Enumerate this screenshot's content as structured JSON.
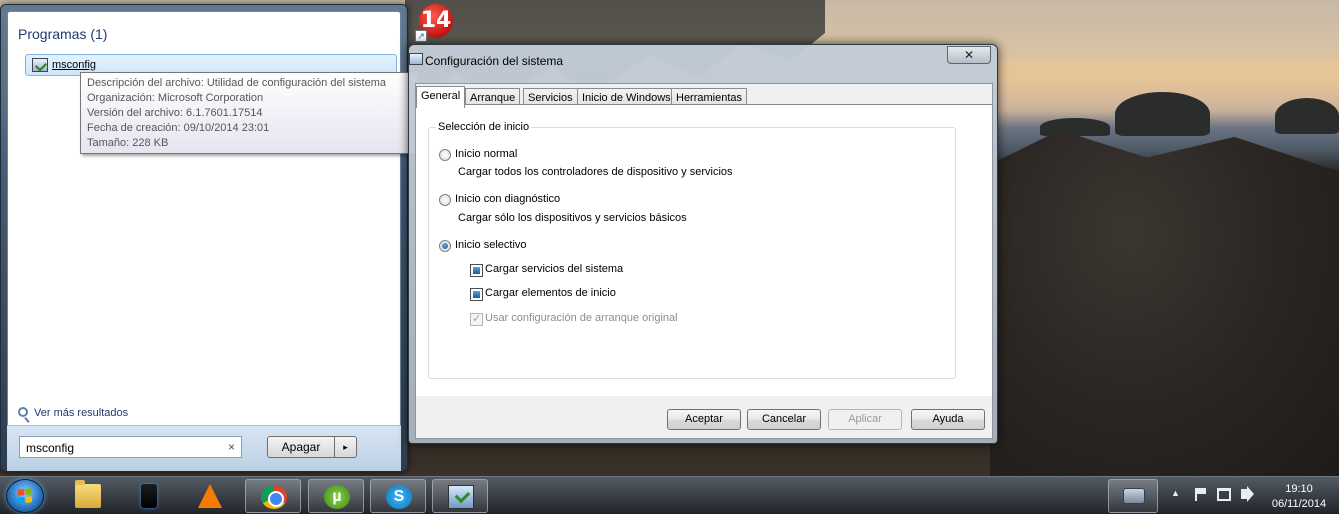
{
  "start_menu": {
    "programs_header": "Programas (1)",
    "program_result": "msconfig",
    "tooltip_lines": [
      "Descripción del archivo: Utilidad de configuración del sistema",
      "Organización: Microsoft Corporation",
      "Versión del archivo: 6.1.7601.17514",
      "Fecha de creación: 09/10/2014 23:01",
      "Tamaño: 228 KB"
    ],
    "more_results": "Ver más resultados",
    "search_value": "msconfig",
    "clear_glyph": "×",
    "shutdown_label": "Apagar",
    "shutdown_arrow": "▸"
  },
  "desktop": {
    "shortcut_badge": "14"
  },
  "window": {
    "title": "Configuración del sistema",
    "close_glyph": "✕",
    "tabs": [
      "General",
      "Arranque",
      "Servicios",
      "Inicio de Windows",
      "Herramientas"
    ],
    "active_tab": "General",
    "group_title": "Selección de inicio",
    "options": [
      {
        "label": "Inicio normal",
        "desc": "Cargar todos los controladores de dispositivo y servicios",
        "checked": false
      },
      {
        "label": "Inicio con diagnóstico",
        "desc": "Cargar sólo los dispositivos y servicios básicos",
        "checked": false
      },
      {
        "label": "Inicio selectivo",
        "desc": "",
        "checked": true
      }
    ],
    "checkboxes": [
      {
        "label": "Cargar servicios del sistema",
        "state": "indeterminate",
        "enabled": true
      },
      {
        "label": "Cargar elementos de inicio",
        "state": "indeterminate",
        "enabled": true
      },
      {
        "label": "Usar configuración de arranque original",
        "state": "checked",
        "enabled": false
      }
    ],
    "buttons": {
      "ok": "Aceptar",
      "cancel": "Cancelar",
      "apply": "Aplicar",
      "help": "Ayuda"
    }
  },
  "taskbar": {
    "pinned": [
      "folder-icon",
      "device-icon",
      "vlc-icon",
      "chrome-icon",
      "utorrent-icon",
      "skype-icon",
      "msconfig-icon"
    ],
    "utorrent_glyph": "µ",
    "skype_glyph": "S",
    "tray_arrow": "▲",
    "time": "19:10",
    "date": "06/11/2014"
  }
}
